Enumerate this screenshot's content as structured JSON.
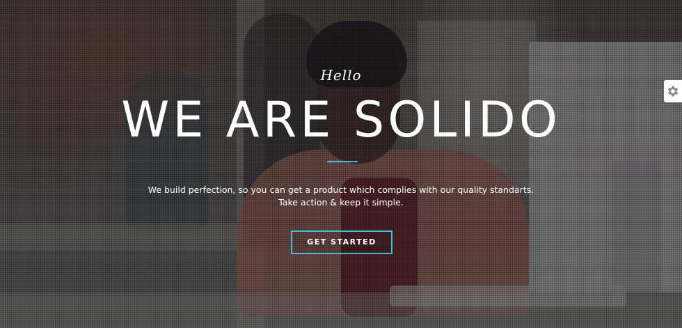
{
  "hero": {
    "greeting": "Hello",
    "title": "WE ARE SOLIDO",
    "description_line1": "We build perfection, so you can get a product which complies with our quality standarts.",
    "description_line2": "Take action & keep it simple.",
    "cta_label": "GET STARTED"
  },
  "settings": {
    "icon": "gear-icon"
  },
  "colors": {
    "accent": "#3fc0d8",
    "text": "#ffffff",
    "overlay": "#18181c"
  }
}
